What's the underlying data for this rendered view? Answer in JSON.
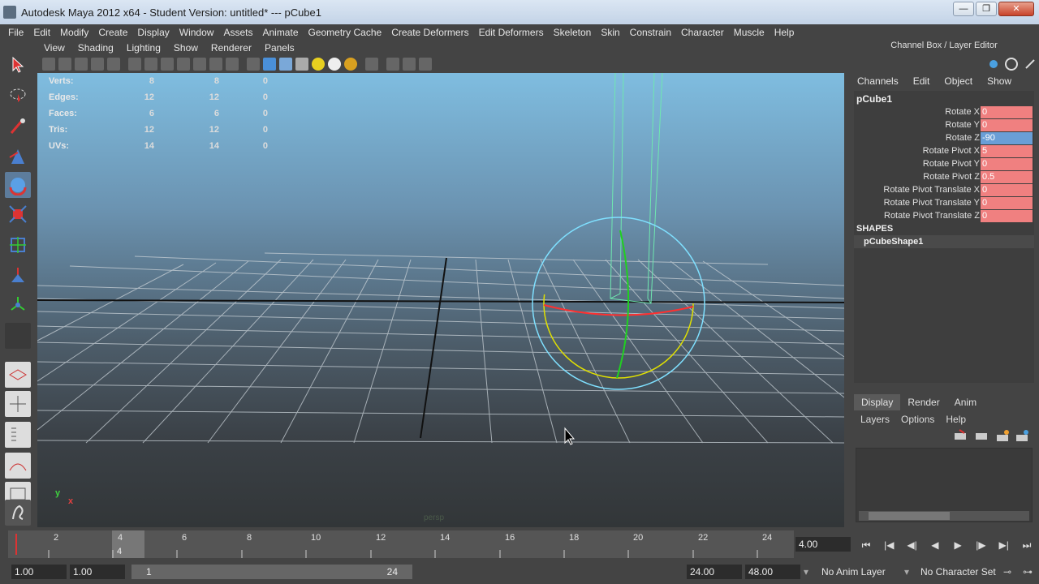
{
  "window": {
    "title": "Autodesk Maya 2012 x64 - Student Version: untitled*   ---   pCube1",
    "min": "—",
    "max": "❐",
    "close": "✕"
  },
  "menubar": [
    "File",
    "Edit",
    "Modify",
    "Create",
    "Display",
    "Window",
    "Assets",
    "Animate",
    "Geometry Cache",
    "Create Deformers",
    "Edit Deformers",
    "Skeleton",
    "Skin",
    "Constrain",
    "Character",
    "Muscle",
    "Help"
  ],
  "panel_menu": [
    "View",
    "Shading",
    "Lighting",
    "Show",
    "Renderer",
    "Panels"
  ],
  "hud": [
    {
      "label": "Verts:",
      "a": "8",
      "b": "8",
      "c": "0"
    },
    {
      "label": "Edges:",
      "a": "12",
      "b": "12",
      "c": "0"
    },
    {
      "label": "Faces:",
      "a": "6",
      "b": "6",
      "c": "0"
    },
    {
      "label": "Tris:",
      "a": "12",
      "b": "12",
      "c": "0"
    },
    {
      "label": "UVs:",
      "a": "14",
      "b": "14",
      "c": "0"
    }
  ],
  "viewport": {
    "camera": "persp",
    "axis_y": "y",
    "axis_x": "x"
  },
  "channel_box": {
    "header": "Channel Box / Layer Editor",
    "menu": [
      "Channels",
      "Edit",
      "Object",
      "Show"
    ],
    "object": "pCube1",
    "attributes": [
      {
        "label": "Rotate X",
        "value": "0"
      },
      {
        "label": "Rotate Y",
        "value": "0"
      },
      {
        "label": "Rotate Z",
        "value": "-90"
      },
      {
        "label": "Rotate Pivot X",
        "value": "5"
      },
      {
        "label": "Rotate Pivot Y",
        "value": "0"
      },
      {
        "label": "Rotate Pivot Z",
        "value": "0.5"
      },
      {
        "label": "Rotate Pivot Translate X",
        "value": "0"
      },
      {
        "label": "Rotate Pivot Translate Y",
        "value": "0"
      },
      {
        "label": "Rotate Pivot Translate Z",
        "value": "0"
      }
    ],
    "shapes_label": "SHAPES",
    "shape": "pCubeShape1"
  },
  "layer_editor": {
    "tabs": [
      "Display",
      "Render",
      "Anim"
    ],
    "menu": [
      "Layers",
      "Options",
      "Help"
    ]
  },
  "timeline": {
    "ticks": [
      "2",
      "4",
      "6",
      "8",
      "10",
      "12",
      "14",
      "16",
      "18",
      "20",
      "22",
      "24"
    ],
    "current_frame": "4",
    "current_time": "4.00",
    "playback": [
      "⏮",
      "|◀",
      "◀|",
      "◀",
      "▶",
      "|▶",
      "▶|",
      "⏭"
    ]
  },
  "range": {
    "start": "1.00",
    "playback_start": "1.00",
    "slider_start": "1",
    "slider_end": "24",
    "playback_end": "24.00",
    "end": "48.00",
    "anim_layer": "No Anim Layer",
    "character_set": "No Character Set"
  },
  "colors": {
    "selected_attr": "#6a9ed6",
    "keyed_attr": "#f08080",
    "viewport_top": "#7fbde0"
  }
}
